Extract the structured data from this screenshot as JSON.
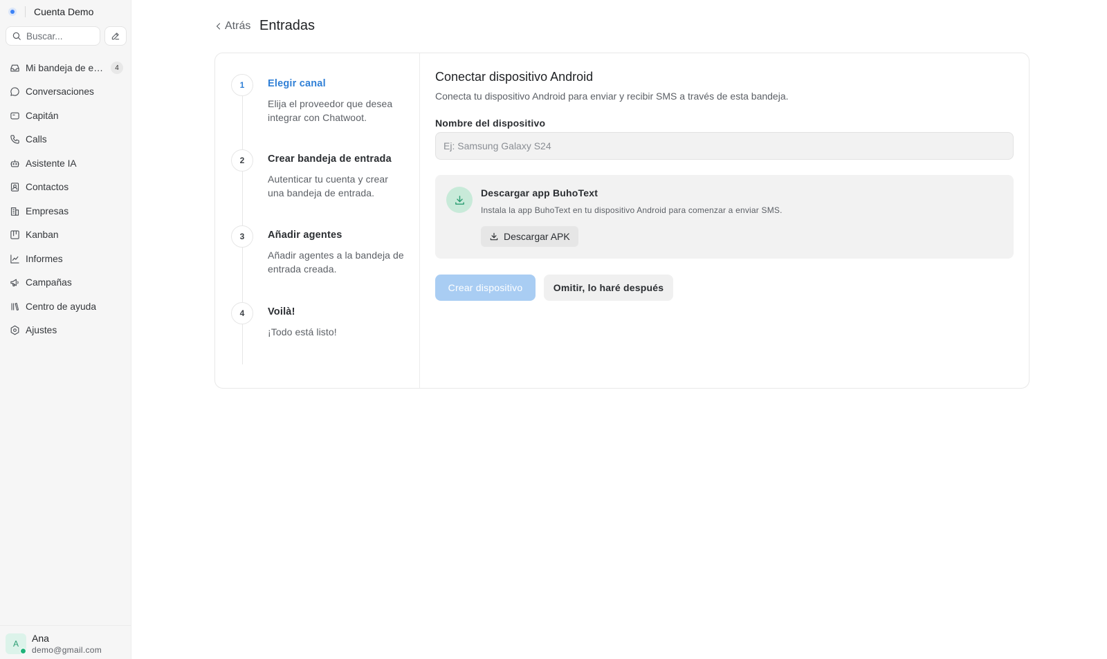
{
  "account": {
    "name": "Cuenta Demo"
  },
  "search": {
    "placeholder": "Buscar..."
  },
  "sidebar": {
    "items": [
      {
        "label": "Mi bandeja de entrada",
        "icon": "inbox-icon",
        "badge": "4"
      },
      {
        "label": "Conversaciones",
        "icon": "chat-bubble-icon"
      },
      {
        "label": "Capitán",
        "icon": "captain-icon"
      },
      {
        "label": "Calls",
        "icon": "phone-icon"
      },
      {
        "label": "Asistente IA",
        "icon": "bot-icon"
      },
      {
        "label": "Contactos",
        "icon": "contact-card-icon"
      },
      {
        "label": "Empresas",
        "icon": "building-icon"
      },
      {
        "label": "Kanban",
        "icon": "kanban-icon"
      },
      {
        "label": "Informes",
        "icon": "line-chart-icon"
      },
      {
        "label": "Campañas",
        "icon": "megaphone-icon"
      },
      {
        "label": "Centro de ayuda",
        "icon": "library-icon"
      },
      {
        "label": "Ajustes",
        "icon": "settings-icon"
      }
    ]
  },
  "user": {
    "initial": "A",
    "name": "Ana",
    "email": "demo@gmail.com",
    "status_color": "#20b37a"
  },
  "header": {
    "back_label": "Atrás",
    "title": "Entradas"
  },
  "steps": [
    {
      "number": "1",
      "title": "Elegir canal",
      "description": "Elija el proveedor que desea integrar con Chatwoot.",
      "active": true
    },
    {
      "number": "2",
      "title": "Crear bandeja de entrada",
      "description": "Autenticar tu cuenta y crear una bandeja de entrada."
    },
    {
      "number": "3",
      "title": "Añadir agentes",
      "description": "Añadir agentes a la bandeja de entrada creada."
    },
    {
      "number": "4",
      "title": "Voilà!",
      "description": "¡Todo está listo!"
    }
  ],
  "form": {
    "title": "Conectar dispositivo Android",
    "subtitle": "Conecta tu dispositivo Android para enviar y recibir SMS a través de esta bandeja.",
    "device_label": "Nombre del dispositivo",
    "device_value": "",
    "device_placeholder": "Ej: Samsung Galaxy S24",
    "download": {
      "title": "Descargar app BuhoText",
      "description": "Instala la app BuhoText en tu dispositivo Android para comenzar a enviar SMS.",
      "button_label": "Descargar APK"
    },
    "create_button": "Crear dispositivo",
    "skip_button": "Omitir, lo haré después"
  },
  "colors": {
    "accent": "#2f7fd6",
    "create_button_disabled": "#a9cdf3",
    "download_icon_bg": "#c8ead9"
  }
}
